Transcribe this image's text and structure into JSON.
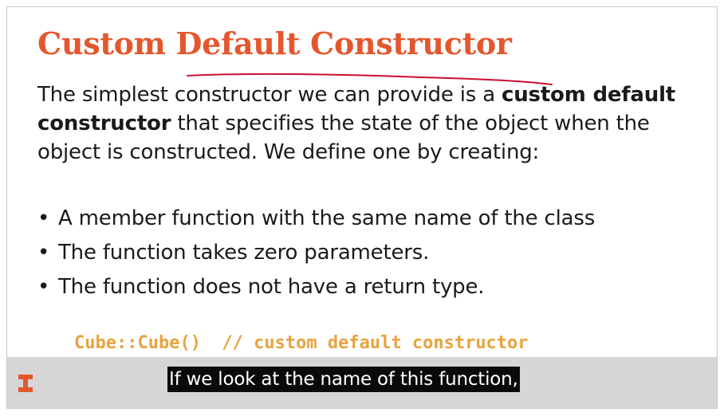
{
  "slide": {
    "title": "Custom Default Constructor",
    "paragraph": {
      "part1": "The simplest constructor we can provide is a ",
      "bold1": "custom default constructor",
      "part2": " that specifies the state of the object when the object is constructed.  We define one by creating:"
    },
    "bullets": [
      "A member function with the same name of the class",
      "The function takes zero parameters.",
      "The function does not have a return type."
    ],
    "bullet_glyph": "•",
    "code_line": "Cube::Cube()  // custom default constructor"
  },
  "caption": {
    "text": "If we look at the name of this function,"
  },
  "colors": {
    "title": "#e4572e",
    "code": "#e8a33d",
    "ink": "#c8102e",
    "logo": "#e4572e",
    "caption_bar": "#d6d6d6",
    "caption_bg": "#0a0a0a"
  },
  "icons": {
    "logo": "illinois-block-i-icon"
  }
}
